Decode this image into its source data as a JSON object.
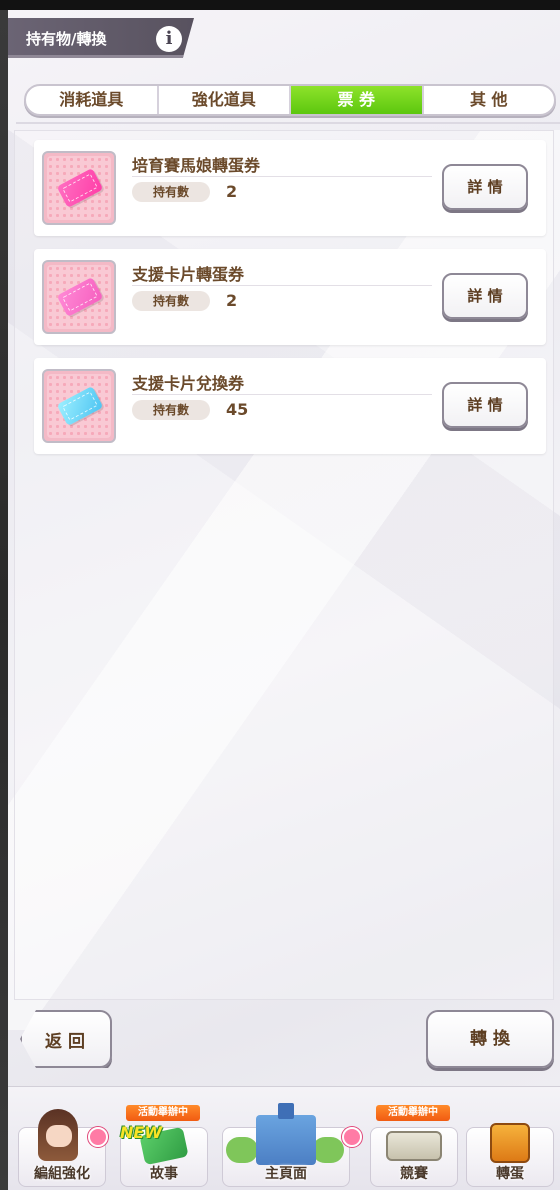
{
  "header": {
    "title": "持有物/轉換",
    "info_icon": "i"
  },
  "tabs": [
    {
      "label": "消耗道具",
      "active": false
    },
    {
      "label": "強化道具",
      "active": false
    },
    {
      "label": "票 券",
      "active": true
    },
    {
      "label": "其 他",
      "active": false
    }
  ],
  "items": [
    {
      "name": "培育賽馬娘轉蛋券",
      "own_label": "持有數",
      "count": "2",
      "detail_label": "詳 情",
      "icon": "pink-ticket-icon"
    },
    {
      "name": "支援卡片轉蛋券",
      "own_label": "持有數",
      "count": "2",
      "detail_label": "詳 情",
      "icon": "magenta-ticket-icon"
    },
    {
      "name": "支援卡片兌換券",
      "own_label": "持有數",
      "count": "45",
      "detail_label": "詳 情",
      "icon": "blue-ticket-icon"
    }
  ],
  "buttons": {
    "back": "返 回",
    "convert": "轉 換"
  },
  "nav": [
    {
      "label": "編組強化",
      "badge": ""
    },
    {
      "label": "故事",
      "badge": "活動舉辦中",
      "new": "NEW"
    },
    {
      "label": "主頁面",
      "badge": ""
    },
    {
      "label": "競賽",
      "badge": "活動舉辦中"
    },
    {
      "label": "轉蛋",
      "badge": ""
    }
  ],
  "colors": {
    "accent_green": "#5cc70f",
    "text_brown": "#6b4a2b",
    "badge_orange": "#f15b12"
  }
}
